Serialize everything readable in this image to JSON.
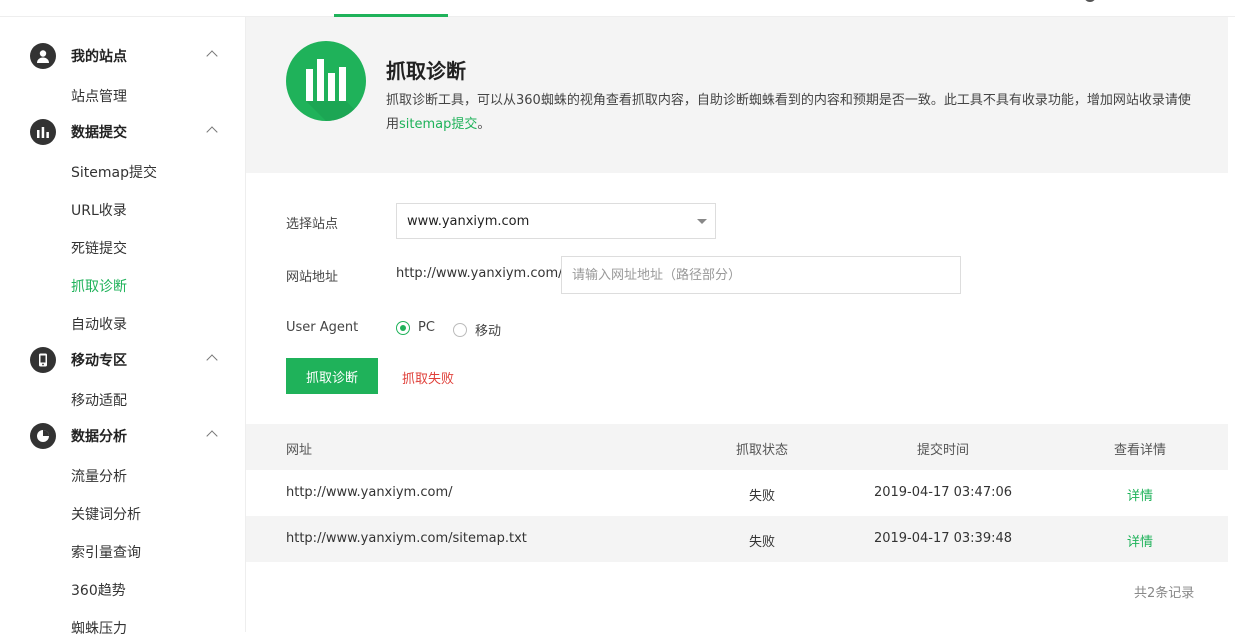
{
  "sidebar": {
    "groups": [
      {
        "title": "我的站点",
        "items": [
          "站点管理"
        ]
      },
      {
        "title": "数据提交",
        "items": [
          "Sitemap提交",
          "URL收录",
          "死链提交",
          "抓取诊断",
          "自动收录"
        ]
      },
      {
        "title": "移动专区",
        "items": [
          "移动适配"
        ]
      },
      {
        "title": "数据分析",
        "items": [
          "流量分析",
          "关键词分析",
          "索引量查询",
          "360趋势",
          "蜘蛛压力"
        ]
      }
    ],
    "active_item": "抓取诊断"
  },
  "banner": {
    "icon": "bar-chart-icon",
    "title": "抓取诊断",
    "desc_text": "抓取诊断工具，可以从360蜘蛛的视角查看抓取内容，自助诊断蜘蛛看到的内容和预期是否一致。此工具不具有收录功能，增加网站收录请使用",
    "desc_link": "sitemap提交",
    "desc_end": "。"
  },
  "form": {
    "site_label": "选择站点",
    "site_value": "www.yanxiym.com",
    "url_label": "网站地址",
    "url_prefix": "http://www.yanxiym.com/",
    "url_placeholder": "请输入网址地址（路径部分）",
    "ua_label": "User Agent",
    "ua_options": [
      "PC",
      "移动"
    ],
    "ua_selected": "PC",
    "submit_label": "抓取诊断",
    "result_msg": "抓取失败"
  },
  "table": {
    "headers": [
      "网址",
      "抓取状态",
      "提交时间",
      "查看详情"
    ],
    "rows": [
      {
        "url": "http://www.yanxiym.com/",
        "status": "失败",
        "time": "2019-04-17 03:47:06",
        "detail": "详情"
      },
      {
        "url": "http://www.yanxiym.com/sitemap.txt",
        "status": "失败",
        "time": "2019-04-17 03:39:48",
        "detail": "详情"
      }
    ],
    "total": "共2条记录"
  },
  "colors": {
    "accent": "#1fb25a",
    "error": "#e0403a"
  }
}
